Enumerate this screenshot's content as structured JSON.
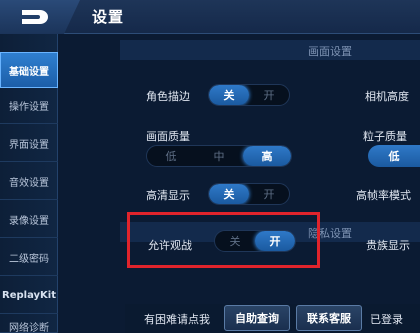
{
  "header": {
    "title": "设置"
  },
  "sidebar": {
    "items": [
      {
        "label": "基础设置"
      },
      {
        "label": "操作设置"
      },
      {
        "label": "界面设置"
      },
      {
        "label": "音效设置"
      },
      {
        "label": "录像设置"
      },
      {
        "label": "二级密码"
      },
      {
        "label": "ReplayKit"
      },
      {
        "label": "网络诊断"
      }
    ]
  },
  "sections": {
    "display": "画面设置",
    "privacy": "隐私设置"
  },
  "settings": {
    "outline": {
      "label": "角色描边",
      "on": "关",
      "off": "开"
    },
    "camera_height": {
      "label": "相机高度"
    },
    "quality": {
      "label": "画面质量",
      "low": "低",
      "mid": "中",
      "high": "高"
    },
    "particle": {
      "label": "粒子质量",
      "value": "低"
    },
    "hd_display": {
      "label": "高清显示",
      "on": "关",
      "off": "开"
    },
    "hfr_mode": {
      "label": "高帧率模式"
    },
    "allow_watch": {
      "label": "允许观战",
      "off": "关",
      "on": "开"
    },
    "noble_display": {
      "label": "贵族显示"
    }
  },
  "bottom": {
    "help_text": "有困难请点我",
    "self_query": "自助查询",
    "contact": "联系客服",
    "logged_in": "已登录"
  }
}
